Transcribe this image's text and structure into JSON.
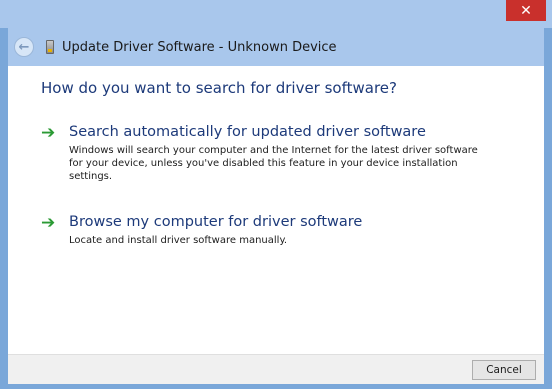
{
  "window": {
    "title": "Update Driver Software - Unknown Device",
    "close_glyph": "✕"
  },
  "back_button": {
    "icon": "back-arrow-icon",
    "glyph": "←"
  },
  "question": "How do you want to search for driver software?",
  "options": [
    {
      "title": "Search automatically for updated driver software",
      "description": "Windows will search your computer and the Internet for the latest driver software for your device, unless you've disabled this feature in your device installation settings.",
      "icon": "green-arrow-icon"
    },
    {
      "title": "Browse my computer for driver software",
      "description": "Locate and install driver software manually.",
      "icon": "green-arrow-icon"
    }
  ],
  "footer": {
    "cancel_label": "Cancel"
  },
  "colors": {
    "frame": "#7aa7d9",
    "header": "#a9c7ec",
    "close": "#c9302c",
    "link_text": "#1d3a7a",
    "arrow": "#2b9a34"
  }
}
